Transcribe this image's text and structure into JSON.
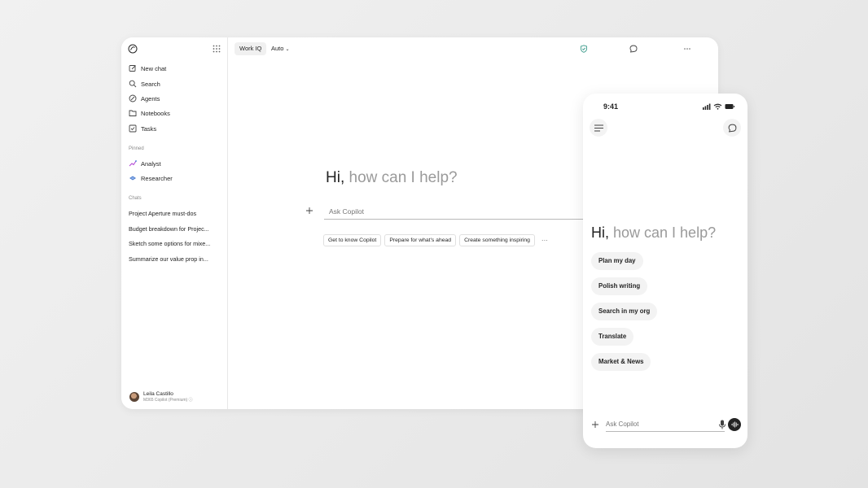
{
  "desktop": {
    "sidebar": {
      "nav": [
        {
          "label": "New chat",
          "icon": "compose-icon"
        },
        {
          "label": "Search",
          "icon": "search-icon"
        },
        {
          "label": "Agents",
          "icon": "agents-icon"
        },
        {
          "label": "Notebooks",
          "icon": "notebook-icon"
        },
        {
          "label": "Tasks",
          "icon": "tasks-icon"
        }
      ],
      "pinned_label": "Pinned",
      "pinned": [
        {
          "label": "Analyst",
          "icon": "analyst-icon"
        },
        {
          "label": "Researcher",
          "icon": "researcher-icon"
        }
      ],
      "chats_label": "Chats",
      "chats": [
        "Project Aperture must-dos",
        "Budget breakdown for Projec...",
        "Sketch some options for mixe...",
        "Summarize our value prop in..."
      ],
      "user": {
        "name": "Leila Castillo",
        "plan": "M365 Copilot (Premium)"
      }
    },
    "topbar": {
      "context": "Work IQ",
      "mode": "Auto"
    },
    "greeting": {
      "hi": "Hi,",
      "rest": " how can I help?"
    },
    "input": {
      "placeholder": "Ask Copilot"
    },
    "chips": [
      "Get to know Copilot",
      "Prepare for what's ahead",
      "Create something inspiring"
    ],
    "more": "···"
  },
  "phone": {
    "time": "9:41",
    "greeting": {
      "hi": "Hi,",
      "rest": " how can I help?"
    },
    "chips": [
      "Plan my day",
      "Polish writing",
      "Search in my org",
      "Translate",
      "Market & News"
    ],
    "input": {
      "placeholder": "Ask Copilot"
    }
  },
  "colors": {
    "shield": "#3a9a8a",
    "text": "#242424",
    "muted": "#9a9a9a"
  }
}
